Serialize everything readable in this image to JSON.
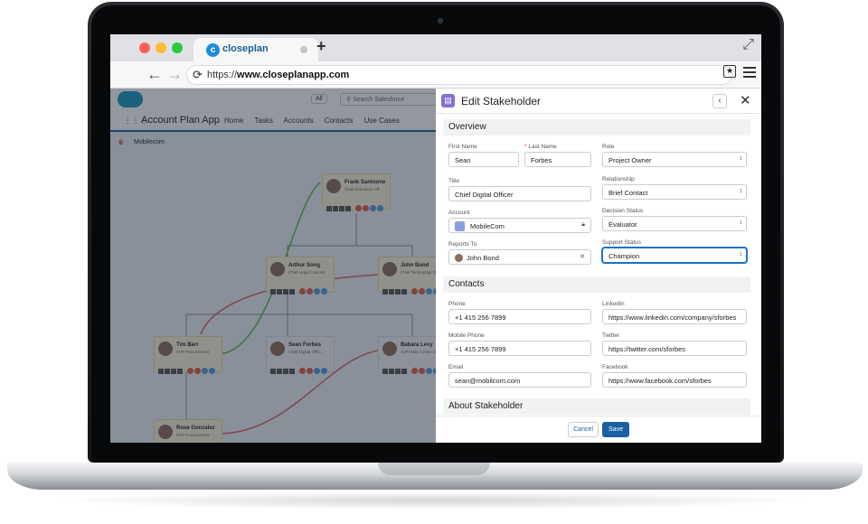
{
  "browser": {
    "tab_title": "closeplan",
    "url_prefix": "https://",
    "url_domain": "www.closeplanapp.com"
  },
  "salesforce": {
    "search_scope": "All",
    "search_placeholder": "Search Salesforce",
    "app_name": "Account Plan App",
    "nav": [
      "Home",
      "Tasks",
      "Accounts",
      "Contacts",
      "Use Cases"
    ],
    "breadcrumb": "Mobilecom",
    "org_chart": [
      {
        "name": "Frank Santoone",
        "role": "Chief Executive Off..."
      },
      {
        "name": "Arthur Song",
        "role": "Chief Legal Counsel"
      },
      {
        "name": "John Bond",
        "role": "Chief Technology Of..."
      },
      {
        "name": "Tim Barr",
        "role": "SVP Procurement"
      },
      {
        "name": "Sean Forbes",
        "role": "Chief Digital Offic..."
      },
      {
        "name": "Babara Levy",
        "role": "SVP Data Center Op..."
      },
      {
        "name": "Rose Gonzalez",
        "role": "SVP Procurement"
      }
    ]
  },
  "panel": {
    "title": "Edit Stakeholder",
    "sections": {
      "overview": "Overview",
      "contacts": "Contacts",
      "about": "About Stakeholder"
    },
    "fields": {
      "first_name": {
        "label": "First Name",
        "value": "Sean"
      },
      "last_name": {
        "label": "Last Name",
        "value": "Forbes",
        "required_mark": "*"
      },
      "role": {
        "label": "Role",
        "value": "Project Owner"
      },
      "title": {
        "label": "Title",
        "value": "Chief Digital Officer"
      },
      "relationship": {
        "label": "Relationship",
        "value": "Brief Contact"
      },
      "account": {
        "label": "Account",
        "value": "MobileCom"
      },
      "decision_status": {
        "label": "Decision Status",
        "value": "Evaluator"
      },
      "reports_to": {
        "label": "Reports To",
        "value": "John Bond"
      },
      "support_status": {
        "label": "Support Status",
        "value": "Champion"
      },
      "phone": {
        "label": "Phone",
        "value": "+1 415 256 7899"
      },
      "linkedin": {
        "label": "LinkedIn",
        "value": "https://www.linkedin.com/company/sforbes"
      },
      "mobile_phone": {
        "label": "Mobile Phone",
        "value": "+1 415 256 7899"
      },
      "twitter": {
        "label": "Twitter",
        "value": "https://twitter.com/sforbes"
      },
      "email": {
        "label": "Email",
        "value": "sean@mobilcom.com"
      },
      "facebook": {
        "label": "Facebook",
        "value": "https://www.facebook.com/sforbes"
      }
    },
    "buttons": {
      "cancel": "Cancel",
      "save": "Save"
    }
  },
  "colors": {
    "brand_blue": "#1b5fa5",
    "panel_icon": "#8570cf",
    "card_bg": "#fbf3dc",
    "connector_green": "#5fbf4f",
    "connector_red": "#e06666"
  },
  "icons": [
    "closeplan-logo-icon",
    "back-arrow-icon",
    "forward-arrow-icon",
    "reload-icon",
    "bookmark-star-icon",
    "hamburger-menu-icon",
    "expand-icon",
    "salesforce-cloud-icon",
    "search-icon",
    "app-launcher-icon",
    "stakeholder-card-icon",
    "chevron-left-icon",
    "close-icon",
    "lock-icon",
    "clear-icon",
    "select-arrow-icon"
  ]
}
